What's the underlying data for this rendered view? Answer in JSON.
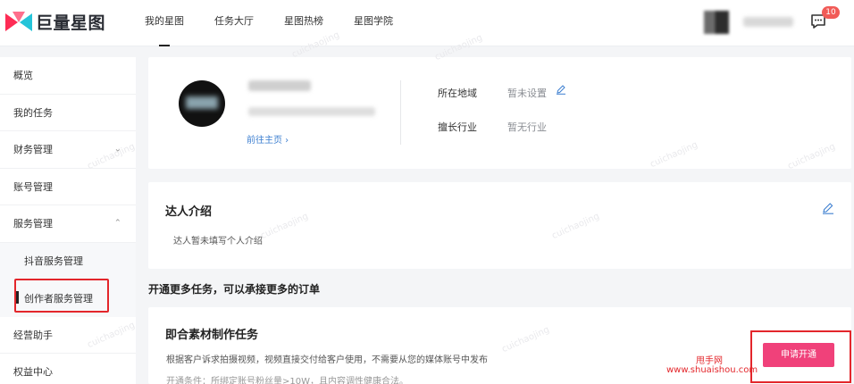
{
  "brand": {
    "name": "巨量星图"
  },
  "nav": [
    "我的星图",
    "任务大厅",
    "星图热榜",
    "星图学院"
  ],
  "header": {
    "message_count": "10"
  },
  "sidebar": {
    "items": [
      "概览",
      "我的任务",
      "财务管理",
      "账号管理",
      "服务管理"
    ],
    "sub_items": [
      "抖音服务管理",
      "创作者服务管理"
    ],
    "items_after": [
      "经营助手",
      "权益中心"
    ]
  },
  "profile": {
    "goto_home": "前往主页 ›",
    "location_label": "所在地域",
    "location_value": "暂未设置",
    "industry_label": "擅长行业",
    "industry_value": "暂无行业"
  },
  "intro": {
    "title": "达人介绍",
    "text": "达人暂未填写个人介绍"
  },
  "open_more": {
    "heading": "开通更多任务，可以承接更多的订单"
  },
  "task": {
    "title": "即合素材制作任务",
    "description": "根据客户诉求拍摄视频，视频直接交付给客户使用，不需要从您的媒体账号中发布",
    "condition": "开通条件：所绑定账号粉丝量>10W，且内容调性健康合法。",
    "apply_label": "申请开通"
  },
  "watermark": {
    "site": "甩手网",
    "url": "www.shuaishou.com",
    "diag": "cuichaojing"
  },
  "colors": {
    "accent": "#f0417a",
    "highlight": "#e3262b",
    "link": "#3d7fd0"
  }
}
